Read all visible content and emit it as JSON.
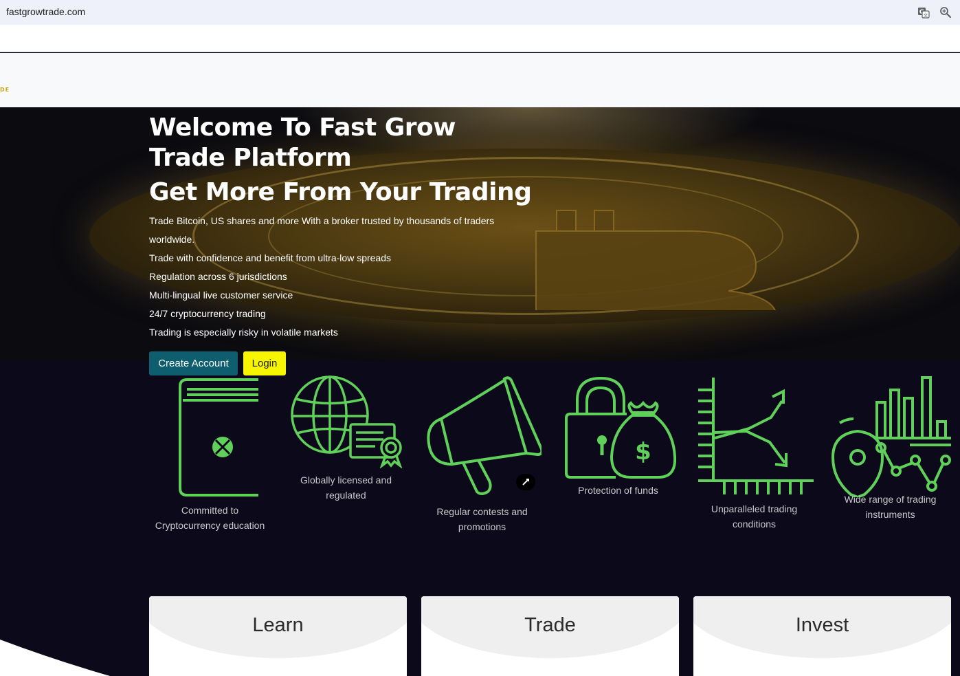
{
  "browser": {
    "url": "fastgrowtrade.com"
  },
  "header": {
    "logo_fragment": "DE"
  },
  "hero": {
    "title": "Welcome To Fast Grow Trade Platform",
    "subtitle": "Get More From Your Trading",
    "lines": [
      "Trade Bitcoin, US shares and more With a broker trusted by thousands of traders worldwide.",
      "Trade with confidence and benefit from ultra-low spreads",
      "Regulation across 6 jurisdictions",
      "Multi-lingual live customer service",
      "24/7 cryptocurrency trading",
      "Trading is especially risky in volatile markets"
    ],
    "create_account_label": "Create Account",
    "login_label": "Login"
  },
  "features": [
    {
      "label": "Committed to Cryptocurrency education",
      "icon": "book-icon"
    },
    {
      "label": "Globally licensed and regulated",
      "icon": "globe-certificate-icon"
    },
    {
      "label": "Regular contests and promotions",
      "icon": "megaphone-icon"
    },
    {
      "label": "Protection of funds",
      "icon": "lock-moneybag-icon"
    },
    {
      "label": "Unparalleled trading conditions",
      "icon": "trend-chart-icon"
    },
    {
      "label": "Wide range of trading instruments",
      "icon": "bar-chart-map-icon"
    }
  ],
  "cards": [
    {
      "title": "Learn"
    },
    {
      "title": "Trade"
    },
    {
      "title": "Invest"
    }
  ],
  "colors": {
    "accent_green": "#5fd05a",
    "create_button": "#0e5e6f",
    "login_button": "#f7f600",
    "page_background": "#0c0a1a"
  }
}
